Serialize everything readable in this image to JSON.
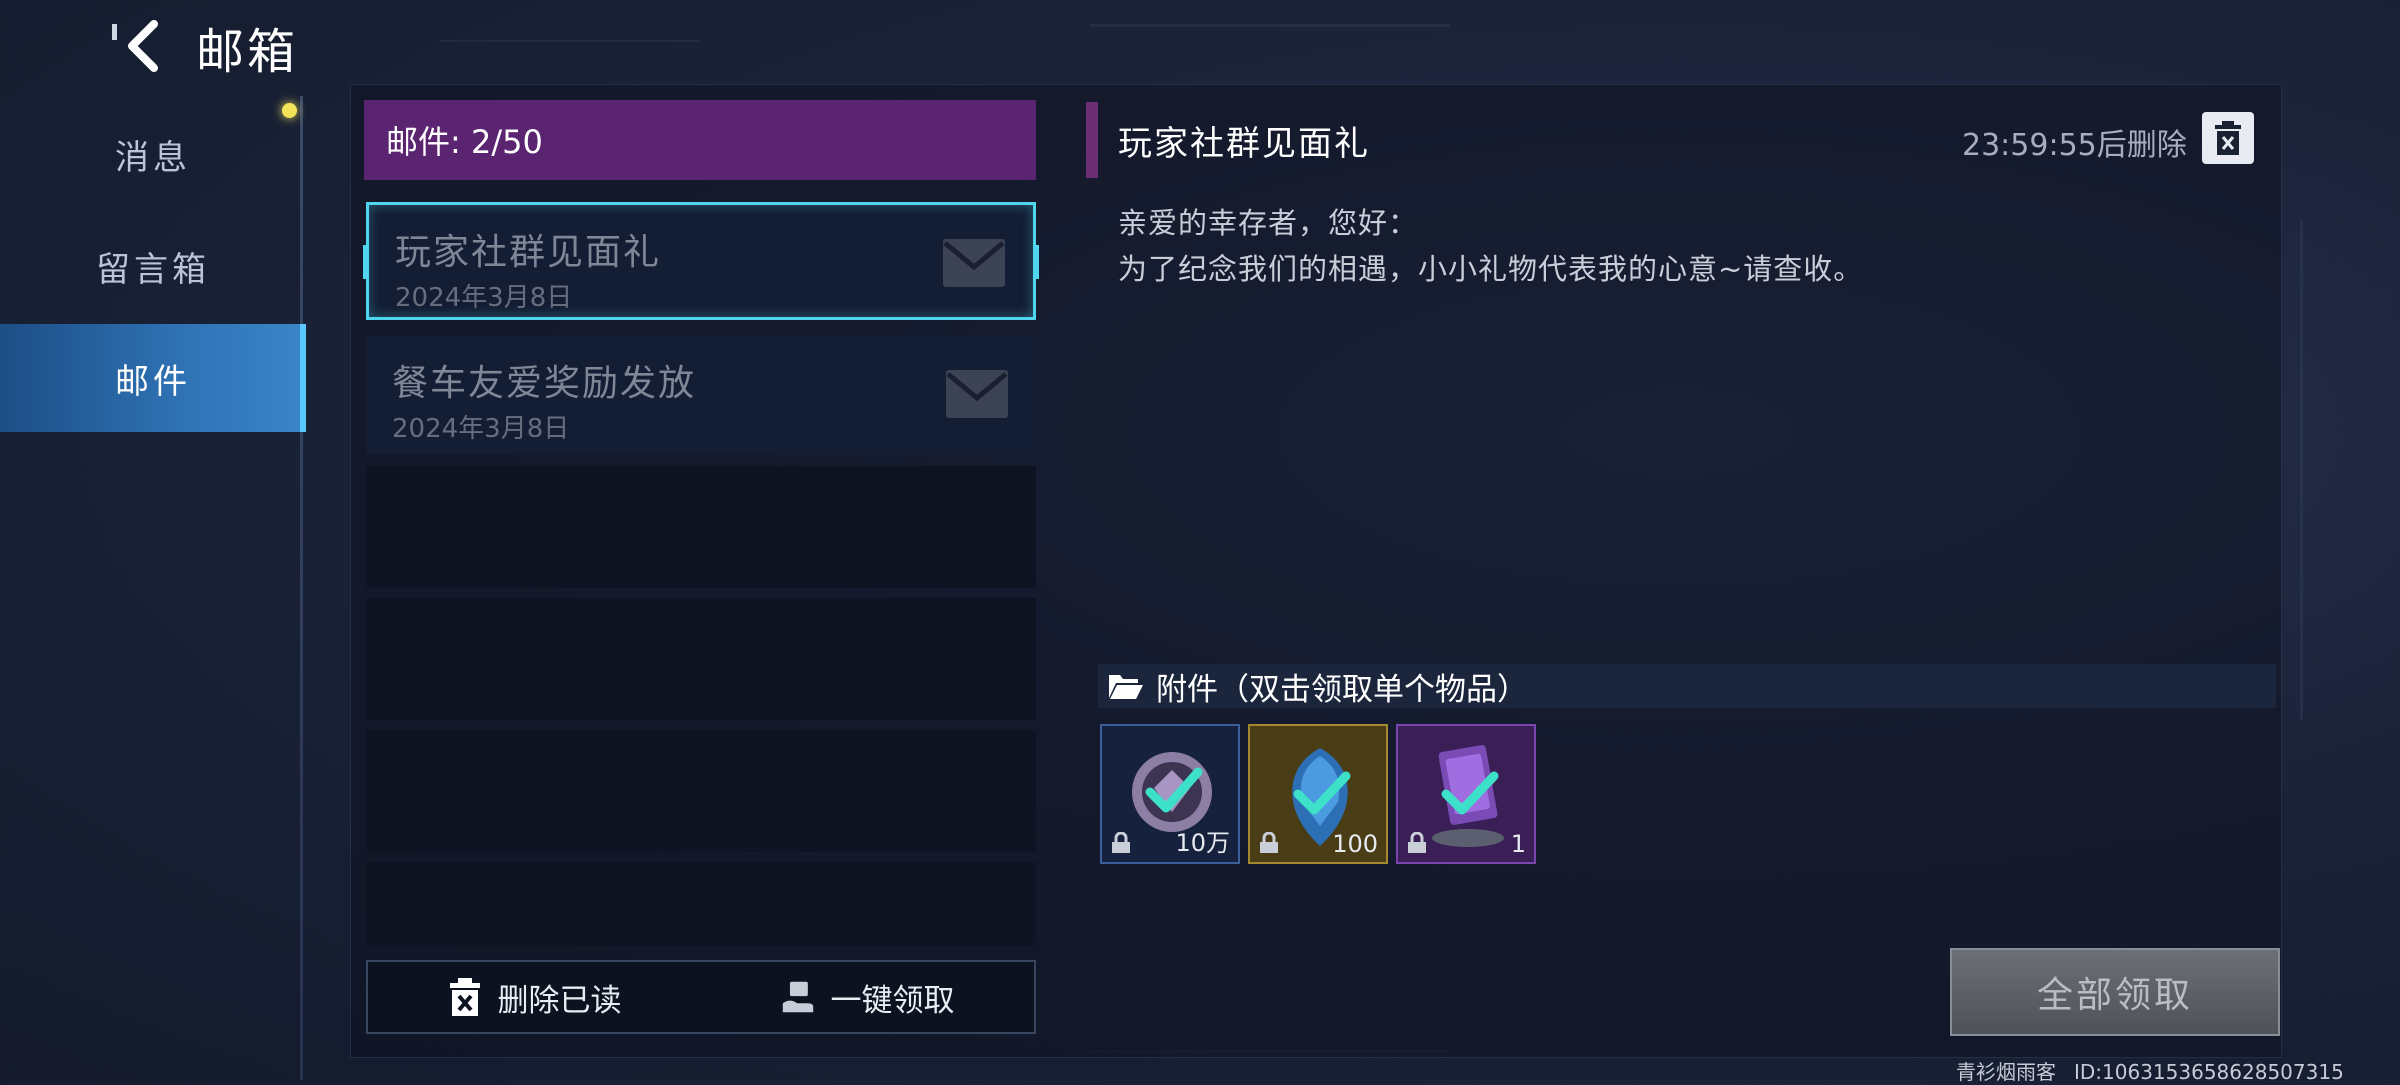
{
  "header": {
    "title": "邮箱",
    "back_icon": "chevron-left-icon"
  },
  "sidebar": {
    "items": [
      {
        "label": "消息",
        "active": false,
        "has_dot": true
      },
      {
        "label": "留言箱",
        "active": false
      },
      {
        "label": "邮件",
        "active": true
      }
    ]
  },
  "mail_list": {
    "count_label": "邮件: 2/50",
    "mails": [
      {
        "subject": "玩家社群见面礼",
        "date": "2024年3月8日",
        "selected": true
      },
      {
        "subject": "餐车友爱奖励发放",
        "date": "2024年3月8日",
        "selected": false
      }
    ],
    "actions": {
      "delete_read": "删除已读",
      "claim_all": "一键领取"
    }
  },
  "detail": {
    "title": "玩家社群见面礼",
    "countdown": "23:59:55后删除",
    "body": [
      "亲爱的幸存者，您好：",
      "为了纪念我们的相遇，小小礼物代表我的心意~请查收。"
    ],
    "attachments_label": "附件（双击领取单个物品）",
    "attachments": [
      {
        "name": "coin",
        "quantity": "10万",
        "frame": "blue",
        "claimed": true
      },
      {
        "name": "gem",
        "quantity": "100",
        "frame": "gold",
        "claimed": true
      },
      {
        "name": "card",
        "quantity": "1",
        "frame": "purple",
        "claimed": true
      }
    ],
    "claim_all_button": "全部领取"
  },
  "footer": {
    "player_name": "青衫烟雨客",
    "player_id": "ID:1063153658628507315"
  },
  "colors": {
    "accent_cyan": "#4fd6ee",
    "count_bar": "#5b2470",
    "sidebar_active": "#2f73b5",
    "notify_dot": "#f2e35a"
  }
}
